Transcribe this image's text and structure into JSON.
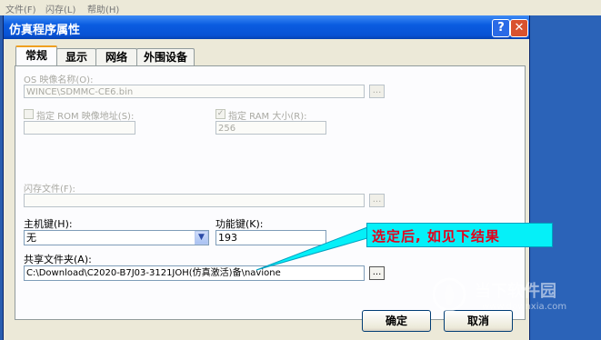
{
  "menubar": {
    "items": [
      "文件(F)",
      "闪存(L)",
      "帮助(H)"
    ]
  },
  "dialog": {
    "title": "仿真程序属性",
    "help_glyph": "?",
    "close_glyph": "✕",
    "tabs": [
      "常规",
      "显示",
      "网络",
      "外围设备"
    ],
    "os_image": {
      "label": "OS 映像名称(O):",
      "value": "WINCE\\SDMMC-CE6.bin",
      "browse": "..."
    },
    "rom": {
      "label": "指定 ROM 映像地址(S):",
      "value": ""
    },
    "ram": {
      "label": "指定 RAM 大小(R):",
      "value": "256",
      "checked": true
    },
    "flash": {
      "label": "闪存文件(F):",
      "value": "",
      "browse": "..."
    },
    "host_key": {
      "label": "主机键(H):",
      "value": "无"
    },
    "func_key": {
      "label": "功能键(K):",
      "value": "193"
    },
    "shared_folder": {
      "label": "共享文件夹(A):",
      "value": "C:\\Download\\C2020-B7J03-3121JOH(仿真激活)备\\navione",
      "browse": "..."
    },
    "ok_label": "确定",
    "cancel_label": "取消"
  },
  "callout": {
    "text": "选定后, 如见下结果",
    "color": "#e4001b",
    "background": "#05f0f8"
  },
  "watermark": {
    "brand": "当下软件园",
    "url": "www.downxia.com"
  }
}
